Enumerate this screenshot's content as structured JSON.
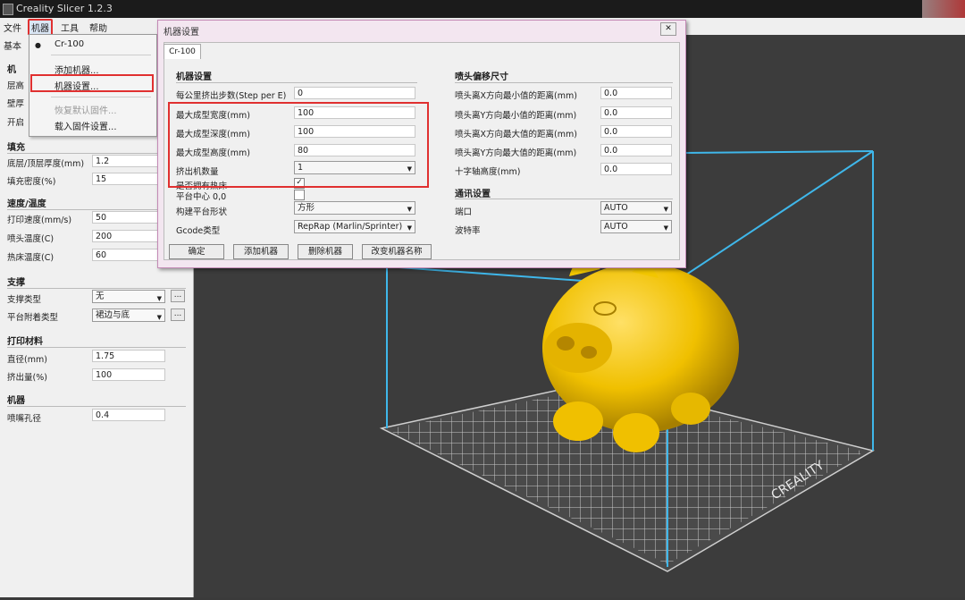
{
  "window": {
    "title": "Creality Slicer 1.2.3"
  },
  "menubar": {
    "items": [
      "文件",
      "机器",
      "工具",
      "帮助"
    ]
  },
  "dropdown": {
    "items": [
      {
        "label": "Cr-100",
        "checked": true,
        "disabled": false
      },
      {
        "label": "添加机器...",
        "disabled": false
      },
      {
        "label": "机器设置...",
        "disabled": false,
        "highlighted": true
      },
      {
        "label": "恢复默认固件...",
        "disabled": true
      },
      {
        "label": "载入固件设置...",
        "disabled": false
      }
    ]
  },
  "leftpanel": {
    "tab": "基本",
    "partial_labels": [
      "机",
      "层高",
      "壁厚",
      "开启"
    ],
    "sections": [
      {
        "title": "填充",
        "rows": [
          {
            "label": "底层/顶层厚度(mm)",
            "value": "1.2"
          },
          {
            "label": "填充密度(%)",
            "value": "15"
          }
        ]
      },
      {
        "title": "速度/温度",
        "rows": [
          {
            "label": "打印速度(mm/s)",
            "value": "50"
          },
          {
            "label": "喷头温度(C)",
            "value": "200"
          },
          {
            "label": "热床温度(C)",
            "value": "60"
          }
        ]
      },
      {
        "title": "支撑",
        "rows": [
          {
            "label": "支撑类型",
            "value": "无"
          },
          {
            "label": "平台附着类型",
            "value": "裙边与底"
          }
        ]
      },
      {
        "title": "打印材料",
        "rows": [
          {
            "label": "直径(mm)",
            "value": "1.75"
          },
          {
            "label": "挤出量(%)",
            "value": "100"
          }
        ]
      },
      {
        "title": "机器",
        "rows": [
          {
            "label": "喷嘴孔径",
            "value": "0.4"
          }
        ]
      }
    ],
    "more_button": "..."
  },
  "dialog": {
    "title": "机器设置",
    "close": "✕",
    "tab": "Cr-100",
    "left_section": "机器设置",
    "left_rows": [
      {
        "label": "每公里挤出步数(Step per E)",
        "value": "0"
      },
      {
        "label": "最大成型宽度(mm)",
        "value": "100"
      },
      {
        "label": "最大成型深度(mm)",
        "value": "100"
      },
      {
        "label": "最大成型高度(mm)",
        "value": "80"
      },
      {
        "label": "挤出机数量",
        "value": "1"
      },
      {
        "label": "是否拥有热床",
        "value": "✓"
      },
      {
        "label": "平台中心 0,0",
        "value": ""
      },
      {
        "label": "构建平台形状",
        "value": "方形"
      },
      {
        "label": "Gcode类型",
        "value": "RepRap (Marlin/Sprinter)"
      }
    ],
    "right_section": "喷头偏移尺寸",
    "right_rows": [
      {
        "label": "喷头离X方向最小值的距离(mm)",
        "value": "0.0"
      },
      {
        "label": "喷头离Y方向最小值的距离(mm)",
        "value": "0.0"
      },
      {
        "label": "喷头离X方向最大值的距离(mm)",
        "value": "0.0"
      },
      {
        "label": "喷头离Y方向最大值的距离(mm)",
        "value": "0.0"
      },
      {
        "label": "十字轴高度(mm)",
        "value": "0.0"
      }
    ],
    "comm_section": "通讯设置",
    "comm_rows": [
      {
        "label": "端口",
        "value": "AUTO"
      },
      {
        "label": "波特率",
        "value": "AUTO"
      }
    ],
    "buttons": [
      "确定",
      "添加机器",
      "删除机器",
      "改变机器名称"
    ]
  },
  "viewport": {
    "bed_label": "CREALITY"
  },
  "colors": {
    "accent_red": "#e03030",
    "model_yellow": "#f0c000",
    "frame_cyan": "#3fb7ea"
  }
}
